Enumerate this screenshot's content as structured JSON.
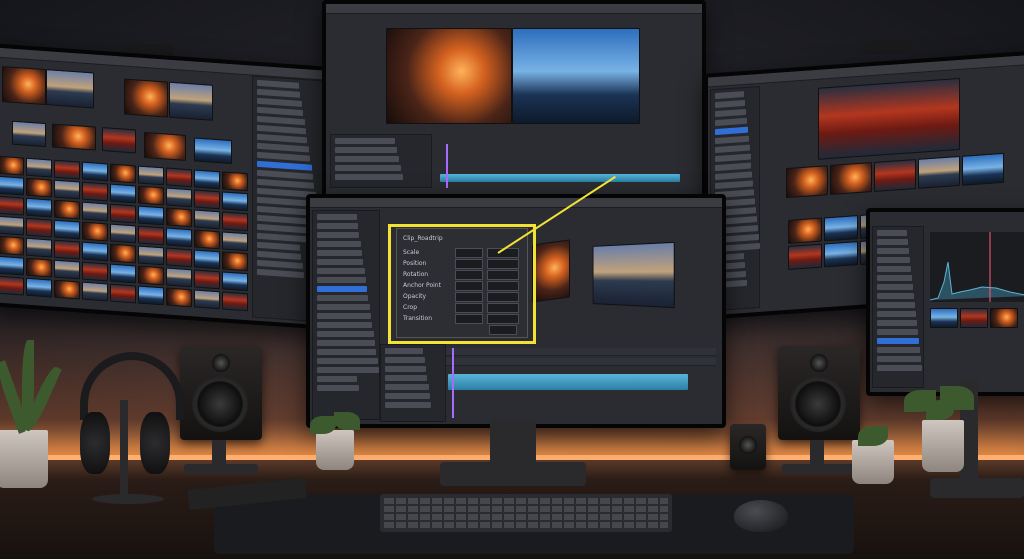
{
  "scene": {
    "dialog_title": "Clip_Roadtrip",
    "dialog_labels": [
      "Scale",
      "Position",
      "Rotation",
      "Anchor Point",
      "Opacity",
      "Crop",
      "Transition"
    ],
    "center_monitor_brand": "",
    "side_monitor_brand": "",
    "speaker_brand": "",
    "accent_highlight": "#f2e233",
    "accent_playhead": "#a66cff",
    "accent_selection": "#2f6fd6"
  }
}
